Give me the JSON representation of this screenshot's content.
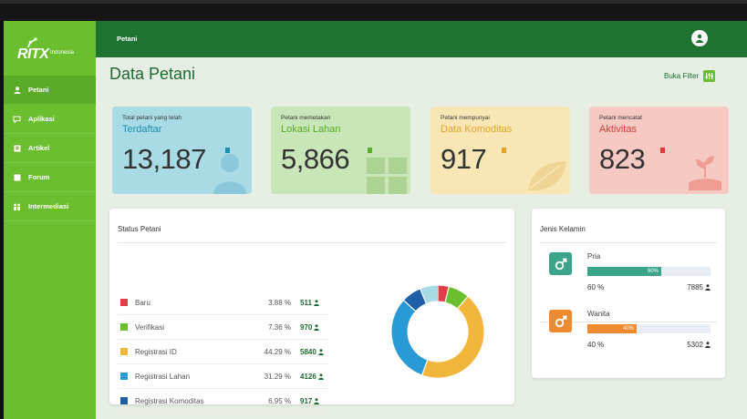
{
  "brand": {
    "name": "RITX",
    "subtitle": "Indonesia"
  },
  "sidebar": {
    "items": [
      {
        "label": "Petani",
        "icon": "user-icon",
        "active": true
      },
      {
        "label": "Aplikasi",
        "icon": "chat-icon",
        "active": false
      },
      {
        "label": "Artikel",
        "icon": "article-icon",
        "active": false
      },
      {
        "label": "Forum",
        "icon": "forum-icon",
        "active": false
      },
      {
        "label": "Intermediasi",
        "icon": "people-icon",
        "active": false
      }
    ]
  },
  "header": {
    "title": "Petani",
    "avatar_icon": "user-avatar-icon"
  },
  "page": {
    "title": "Data Petani",
    "filter_label": "Buka Filter"
  },
  "cards": [
    {
      "caption": "Total petani yang telah",
      "headline": "Terdaftar",
      "value": "13,187",
      "color": "#a9dbe7",
      "accent": "#1c8fb0"
    },
    {
      "caption": "Petani memetakan",
      "headline": "Lokasi Lahan",
      "value": "5,866",
      "color": "#c9e6b8",
      "accent": "#5aab25"
    },
    {
      "caption": "Petani mempunyai",
      "headline": "Data Komoditas",
      "value": "917",
      "color": "#f8e7b5",
      "accent": "#e0a526"
    },
    {
      "caption": "Petani mencatat",
      "headline": "Aktivitas",
      "value": "823",
      "color": "#f6c9c3",
      "accent": "#e0383c"
    }
  ],
  "status": {
    "title": "Status Petani",
    "rows": [
      {
        "name": "Baru",
        "percent": "3.88 %",
        "count": "511",
        "color": "#e0404a"
      },
      {
        "name": "Verifikasi",
        "percent": "7.36 %",
        "count": "970",
        "color": "#6bbf2f"
      },
      {
        "name": "Registrasi ID",
        "percent": "44.29 %",
        "count": "5840",
        "color": "#f2b63c"
      },
      {
        "name": "Registrasi Lahan",
        "percent": "31.29 %",
        "count": "4126",
        "color": "#2a9ad6"
      },
      {
        "name": "Registrasi Komoditas",
        "percent": "6.95 %",
        "count": "917",
        "color": "#1f5fa8"
      }
    ]
  },
  "gender": {
    "title": "Jenis Kelamin",
    "rows": [
      {
        "name": "Pria",
        "bar_label": "60%",
        "percent": "60 %",
        "count": "7885",
        "fraction": 0.6,
        "color": "#3aa58a"
      },
      {
        "name": "Wanita",
        "bar_label": "40%",
        "percent": "40 %",
        "count": "5302",
        "fraction": 0.4,
        "color": "#f08a30"
      }
    ]
  },
  "chart_data": {
    "type": "pie",
    "categories": [
      "Baru",
      "Verifikasi",
      "Registrasi ID",
      "Registrasi Lahan",
      "Registrasi Komoditas"
    ],
    "values": [
      3.88,
      7.36,
      44.29,
      31.29,
      6.95
    ],
    "remainder_color": "#a9dbe7",
    "colors": [
      "#e0404a",
      "#6bbf2f",
      "#f2b63c",
      "#2a9ad6",
      "#1f5fa8"
    ]
  }
}
